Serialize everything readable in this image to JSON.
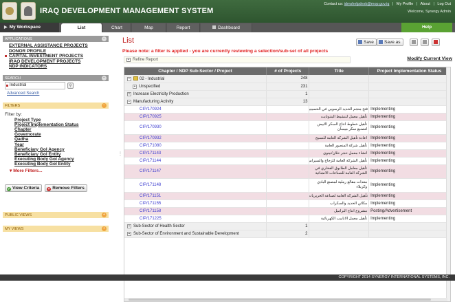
{
  "header": {
    "title": "IRAQ DEVELOPMENT MANAGEMENT SYSTEM",
    "contact_label": "Contact us:",
    "contact_email": "idmshelpdesk@mop.gov.iq",
    "links": [
      "My Profile",
      "About",
      "Log Out"
    ],
    "welcome": "Welcome,  Synergy Admin"
  },
  "nav": {
    "workspace": "My Workspace",
    "tabs": [
      "List",
      "Chart",
      "Map",
      "Report",
      "Dashboard"
    ],
    "active_tab": "List",
    "help": "Help"
  },
  "sidebar": {
    "applications_title": "APPLICATIONS",
    "applications": [
      "EXTERNAL ASSISTANCE PROJECTS",
      "DONOR PROFILE",
      "CAPITAL INVESTMENT PROJECTS",
      "IRAQ DEVELOPMENT PROJECTS",
      "NDP INDICATORS"
    ],
    "search_title": "SEARCH",
    "search_value": "Industrial",
    "advanced_search": "Advanced Search",
    "filters_title": "FILTERS",
    "filter_by": "Filter by:",
    "filters": [
      "Project Type",
      "Project Implementation Status",
      "Chapter",
      "Governorate",
      "Qadha",
      "Year",
      "Beneficiary GoI Agency",
      "Beneficiary GoI Entity",
      "Executing Body GoI Agency",
      "Executing Body GoI Entity"
    ],
    "more_filters": "More Filters...",
    "view_criteria": "View Criteria",
    "remove_filters": "Remove Filters",
    "public_views": "PUBLIC VIEWS",
    "my_views": "MY VIEWS"
  },
  "main": {
    "title": "List",
    "notice": "Please note: a filter is applied - you are currently reviewing a selection/sub-set of all projects",
    "save": "Save",
    "save_as": "Save as",
    "modify_view": "Modify Current View",
    "refine_report": "Refine Report",
    "columns": [
      "Chapter / NDP Sub-Sector / Project",
      "# of Projects",
      "Title",
      "Project Implementation Status"
    ]
  },
  "rows": [
    {
      "kind": "grp",
      "exp": "−",
      "label": "02 - Industrial",
      "count": "248",
      "title": "",
      "status": "",
      "indent": 0,
      "folder": true
    },
    {
      "kind": "grp",
      "exp": "+",
      "label": "Unspecified",
      "count": "231",
      "title": "",
      "status": "",
      "indent": 1
    },
    {
      "kind": "grp",
      "exp": "+",
      "label": "Increase Electricity Production",
      "count": "1",
      "title": "",
      "status": "",
      "indent": 0
    },
    {
      "kind": "grp",
      "exp": "−",
      "label": "Manufacturing Activity",
      "count": "13",
      "title": "",
      "status": "",
      "indent": 0
    },
    {
      "kind": "proj",
      "label": "CIP/170924",
      "count": "",
      "title": "فتح منجم الحديد الرسوبي في الحسينيات",
      "status": "Implementing"
    },
    {
      "kind": "proj",
      "label": "CIP/170925",
      "count": "",
      "title": "تأهيل معمل لتنشيط البنتونايت",
      "status": "Implementing"
    },
    {
      "kind": "proj",
      "label": "CIP/170930",
      "count": "",
      "title": "تأهيل خطوط انتاج السكر الابيض لتصنيع سكر ميسان",
      "status": "Implementing"
    },
    {
      "kind": "proj",
      "label": "CIP/170932",
      "count": "",
      "title": "اعادة تأهيل الشركة العامة للنسيج",
      "status": "Implementing"
    },
    {
      "kind": "proj",
      "label": "CIP/171080",
      "count": "",
      "title": "تأهيل شركة المنصور العامة",
      "status": "Implementing"
    },
    {
      "kind": "proj",
      "label": "CIP/171143",
      "count": "",
      "title": "انشاء معمل حجر حلان/نينوى",
      "status": "Implementing"
    },
    {
      "kind": "proj",
      "label": "CIP/171144",
      "count": "",
      "title": "تأهيل الشركة العامة للزجاج والسيراميك",
      "status": "Implementing"
    },
    {
      "kind": "proj",
      "label": "CIP/171147",
      "count": "",
      "title": "تأهيل معامل الطابوق الفخاري في الشركة العامة للصناعات الانشائية",
      "status": "Implementing"
    },
    {
      "kind": "proj",
      "label": "CIP/171148",
      "count": "",
      "title": "معدات مقالع رملية لمصنع البادي وكربلاء",
      "status": "Implementing"
    },
    {
      "kind": "proj",
      "label": "CIP/171151",
      "count": "",
      "title": "تأهيل الشركة العامة لصناعة الحريريات",
      "status": "Implementing"
    },
    {
      "kind": "proj",
      "label": "CIP/171155",
      "count": "",
      "title": "مكائن الحديد والسكراب",
      "status": "Implementing"
    },
    {
      "kind": "proj",
      "label": "CIP/171158",
      "count": "",
      "title": "مشروع انتاج البراميل",
      "status": "Posting/Advertisement"
    },
    {
      "kind": "proj",
      "label": "CIP/171225",
      "count": "",
      "title": "تأهيل معمل الانابيب الكهربائية",
      "status": "Implementing"
    },
    {
      "kind": "grp",
      "exp": "+",
      "label": "Sub-Sector of  Health Sector",
      "count": "1",
      "title": "",
      "status": "",
      "indent": 0
    },
    {
      "kind": "grp",
      "exp": "+",
      "label": "Sub-Sector of Environment and Sustainable Development",
      "count": "2",
      "title": "",
      "status": "",
      "indent": 0
    }
  ],
  "footer": "COPYRIGHT 2014 SYNERGY INTERNATIONAL SYSTEMS, INC."
}
